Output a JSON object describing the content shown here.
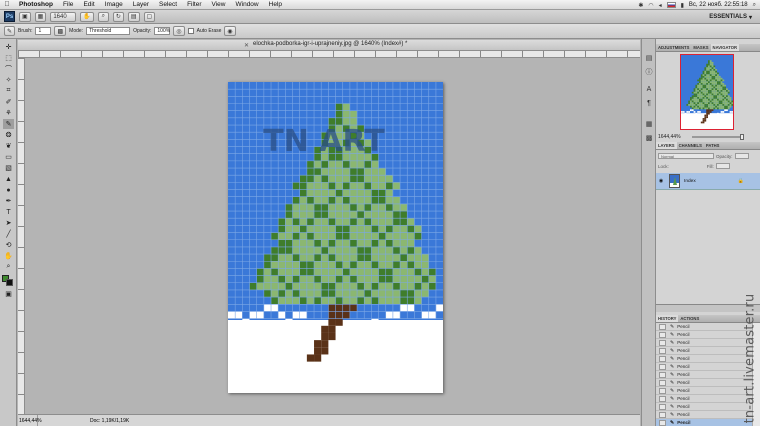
{
  "menubar": {
    "app_name": "Photoshop",
    "items": [
      "File",
      "Edit",
      "Image",
      "Layer",
      "Select",
      "Filter",
      "View",
      "Window",
      "Help"
    ],
    "clock": "Вс, 22 нояб.  22:55:18",
    "status_icons": [
      "bluetooth-icon",
      "wifi-icon",
      "volume-icon",
      "flag-ru-icon",
      "battery-icon",
      "spotlight-icon"
    ]
  },
  "appbar": {
    "logo": "Ps",
    "zoom_value": "1640",
    "workspace": "ESSENTIALS"
  },
  "options": {
    "brush_label": "Brush:",
    "brush_size": "1",
    "mode_label": "Mode:",
    "mode_value": "Threshold",
    "opacity_label": "Opacity:",
    "opacity_value": "100%",
    "auto_erase_label": "Auto Erase"
  },
  "document": {
    "title": "elochka-podborka-igr-i-uprajneniy.jpg @ 1640% (Index#) *",
    "watermark_logo": "TN ART"
  },
  "status": {
    "zoom": "1644,44%",
    "doc_info": "Doc: 1,19K/1,19K"
  },
  "navigator": {
    "tabs": [
      "ADJUSTMENTS",
      "MASKS",
      "NAVIGATOR"
    ],
    "zoom": "1644,44%"
  },
  "layers": {
    "tabs": [
      "LAYERS",
      "CHANNELS",
      "PATHS"
    ],
    "blend_mode": "Normal",
    "opacity_label": "Opacity:",
    "lock_label": "Lock:",
    "fill_label": "Fill:",
    "layer_name": "Index"
  },
  "history": {
    "tabs": [
      "HISTORY",
      "ACTIONS"
    ],
    "items": [
      "Pencil",
      "Pencil",
      "Pencil",
      "Pencil",
      "Pencil",
      "Pencil",
      "Pencil",
      "Pencil",
      "Pencil",
      "Pencil",
      "Pencil",
      "Pencil",
      "Pencil"
    ]
  },
  "watermark_text": "tn-art.livemaster.ru",
  "colors": {
    "sky": "#3a78d8",
    "grid": "#7ca7e6",
    "tree_dark": "#3f7d2b",
    "tree_light": "#8bb771",
    "trunk": "#5a3218",
    "snow": "#ffffff",
    "foreground": "#3f8a2e",
    "background": "#111111"
  }
}
